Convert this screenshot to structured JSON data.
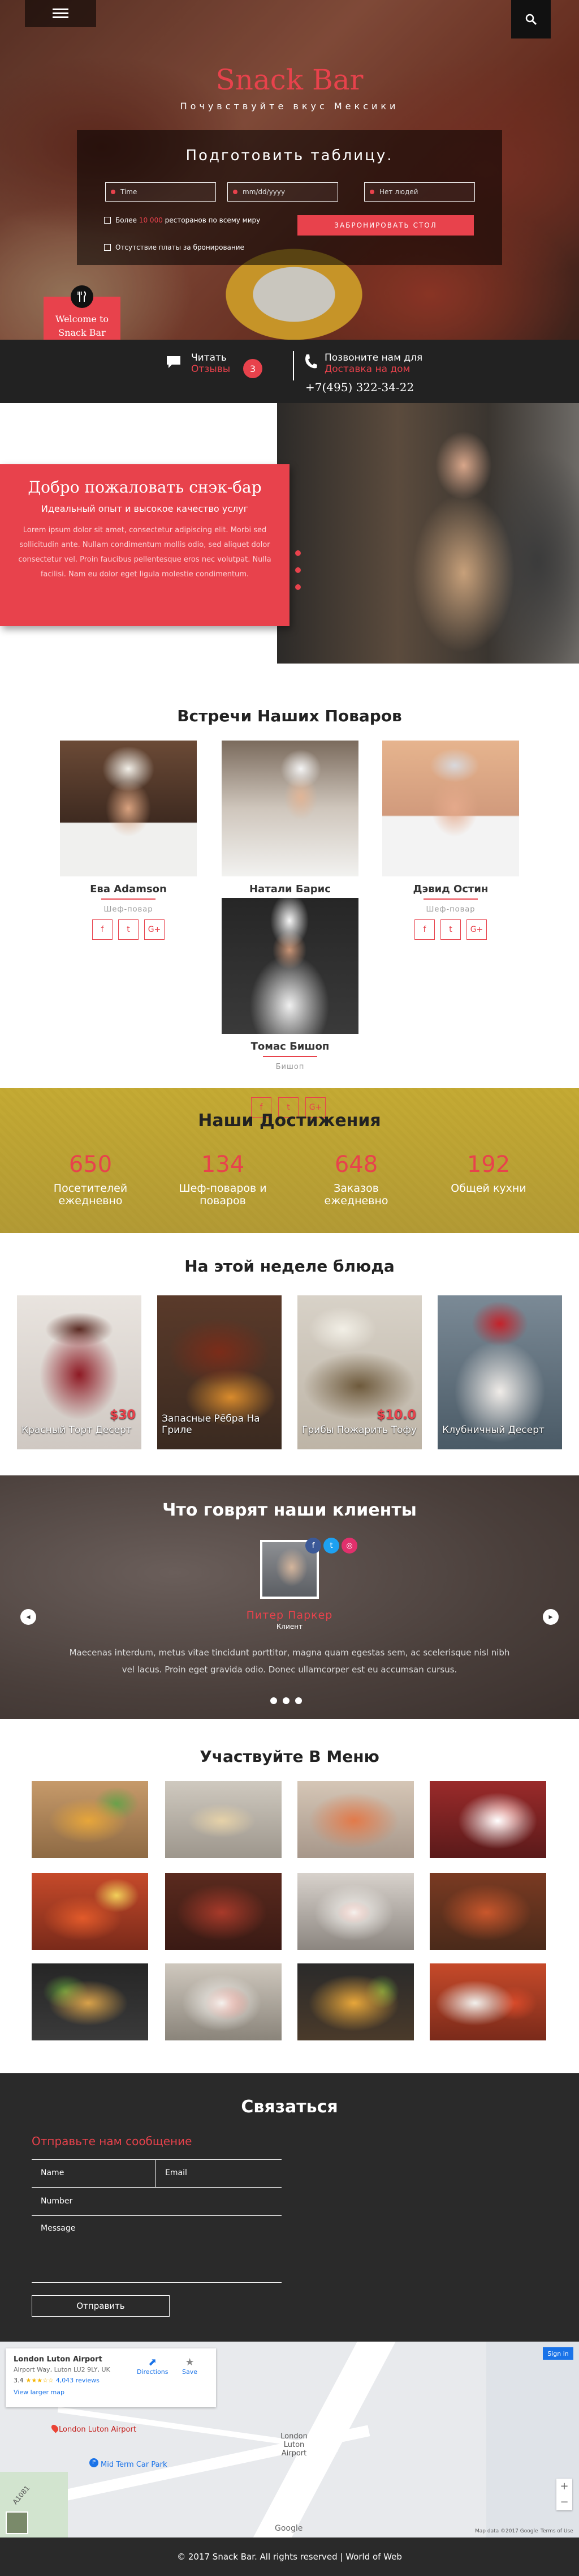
{
  "header": {
    "brand": "Snack Bar",
    "tagline": "Почувствуйте вкус Мексики",
    "booking": {
      "title": "Подготовить таблицу.",
      "time_placeholder": "Time",
      "date_placeholder": "mm/dd/yyyy",
      "people_placeholder": "Нет людей",
      "check1_prefix": "Более",
      "check1_highlight": "10 000",
      "check1_suffix": "ресторанов по всему миру",
      "check2": "Отсутствие платы за бронирование",
      "submit": "ЗАБРОНИРОВАТЬ СТОЛ"
    },
    "badge": {
      "line1": "Welcome to",
      "line2": "Snack Bar"
    }
  },
  "infobar": {
    "read_label": "Читать",
    "reviews_label": "Отзывы",
    "reviews_count": "3",
    "call_label": "Позвоните нам для",
    "delivery_label": "Доставка на дом",
    "phone": "+7(495) 322-34-22"
  },
  "welcome": {
    "title": "Добро пожаловать снэк-бар",
    "lead": "Идеальный опыт и высокое качество услуг",
    "body": "Lorem ipsum dolor sit amet, consectetur adipiscing elit. Morbi sed sollicitudin ante. Nullam condimentum mollis odio, sed aliquet dolor consectetur vel. Proin faucibus pellentesque eros nec volutpat. Nulla facilisi. Nam eu dolor eget ligula molestie condimentum."
  },
  "chefs": {
    "title": "Встречи Наших Поваров",
    "items": [
      {
        "name": "Ева Adamson",
        "role": "Шеф-повар"
      },
      {
        "name": "Натали Барис",
        "role": ""
      },
      {
        "name": "Дэвид Остин",
        "role": "Шеф-повар"
      },
      {
        "name": "Томас Бишоп",
        "role": "Бишоп"
      }
    ],
    "social": [
      "f",
      "t",
      "G+"
    ]
  },
  "achievements": {
    "title": "Наши Достижения",
    "items": [
      {
        "num": "650",
        "label": "Посетителей ежедневно"
      },
      {
        "num": "134",
        "label": "Шеф-поваров и поваров"
      },
      {
        "num": "648",
        "label": "Заказов ежедневно"
      },
      {
        "num": "192",
        "label": "Общей кухни"
      }
    ]
  },
  "dishes": {
    "title": "На этой неделе блюда",
    "items": [
      {
        "name": "Красный Торт Десерт",
        "price": "$30"
      },
      {
        "name": "Запасные Рёбра На Гриле",
        "price": ""
      },
      {
        "name": "Грибы Пожарить Тофу",
        "price": "$10.0"
      },
      {
        "name": "Клубничный Десерт",
        "price": ""
      }
    ]
  },
  "testimonials": {
    "title": "Что говрят наши клиенты",
    "name": "Питер Паркер",
    "role": "Клиент",
    "quote": "Maecenas interdum, metus vitae tincidunt porttitor, magna quam egestas sem, ac scelerisque nisl nibh vel lacus. Proin eget gravida odio. Donec ullamcorper est eu accumsan cursus."
  },
  "gallery": {
    "title": "Участвуйте В Меню"
  },
  "contact": {
    "title": "Связаться",
    "subtitle": "Отправьте нам сообщение",
    "name_placeholder": "Name",
    "email_placeholder": "Email",
    "number_placeholder": "Number",
    "message_placeholder": "Message",
    "submit": "Отправить"
  },
  "map": {
    "place": "London Luton Airport",
    "address": "Airport Way, Luton LU2 9LY, UK",
    "rating": "3.4",
    "reviews": "4,043 reviews",
    "larger": "View larger map",
    "directions": "Directions",
    "save": "Save",
    "label_airport": "London Luton Airport",
    "label_parking": "Mid Term Car Park",
    "signin": "Sign in",
    "attribution": "Map data ©2017 Google",
    "terms": "Terms of Use",
    "road": "A1081",
    "google": "Google"
  },
  "footer": {
    "text": "© 2017 Snack Bar. All rights reserved | World of Web"
  },
  "colors": {
    "accent": "#e8424c",
    "dark": "#2a2a2a"
  }
}
